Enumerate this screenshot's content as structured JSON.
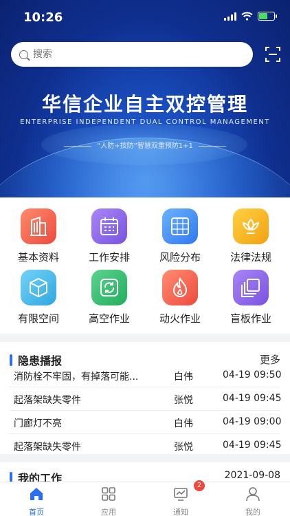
{
  "status": {
    "time": "10:26"
  },
  "search": {
    "placeholder": "搜索"
  },
  "banner": {
    "title": "华信企业自主双控管理",
    "subtitle": "ENTERPRISE INDEPENDENT DUAL CONTROL MANAGEMENT",
    "slogan": "“人防+技防”智慧双重预防1+1"
  },
  "grid": {
    "items": [
      {
        "label": "基本资料",
        "icon": "building-icon",
        "color": "#f05a4a"
      },
      {
        "label": "工作安排",
        "icon": "calendar-icon",
        "color": "#8a63e8"
      },
      {
        "label": "风险分布",
        "icon": "grid-icon",
        "color": "#3d8df5"
      },
      {
        "label": "法律法规",
        "icon": "lotus-icon",
        "color": "#f7b31d"
      },
      {
        "label": "有限空间",
        "icon": "cube-icon",
        "color": "#3cb5e8"
      },
      {
        "label": "高空作业",
        "icon": "recycle-icon",
        "color": "#2fbf6e"
      },
      {
        "label": "动火作业",
        "icon": "fire-icon",
        "color": "#f2574a"
      },
      {
        "label": "盲板作业",
        "icon": "layers-icon",
        "color": "#8a63e8"
      }
    ]
  },
  "hazard": {
    "title": "隐患播报",
    "more": "更多",
    "rows": [
      {
        "desc": "消防栓不牢固，有掉落可能...",
        "person": "白伟",
        "time": "04-19 09:50"
      },
      {
        "desc": "起落架缺失零件",
        "person": "张悦",
        "time": "04-19 09:45"
      },
      {
        "desc": "门廊灯不亮",
        "person": "白伟",
        "time": "04-19 09:00"
      },
      {
        "desc": "起落架缺失零件",
        "person": "张悦",
        "time": "04-19 09:45"
      }
    ]
  },
  "work": {
    "title": "我的工作",
    "date": "2021-09-08"
  },
  "tabs": [
    {
      "label": "首页",
      "icon": "home-icon"
    },
    {
      "label": "应用",
      "icon": "apps-icon"
    },
    {
      "label": "通知",
      "icon": "monitor-icon"
    },
    {
      "label": "我的",
      "icon": "user-icon"
    }
  ],
  "notify_badge": "2",
  "colors": {
    "accent": "#2b6ef2",
    "badge": "#f0463c"
  }
}
